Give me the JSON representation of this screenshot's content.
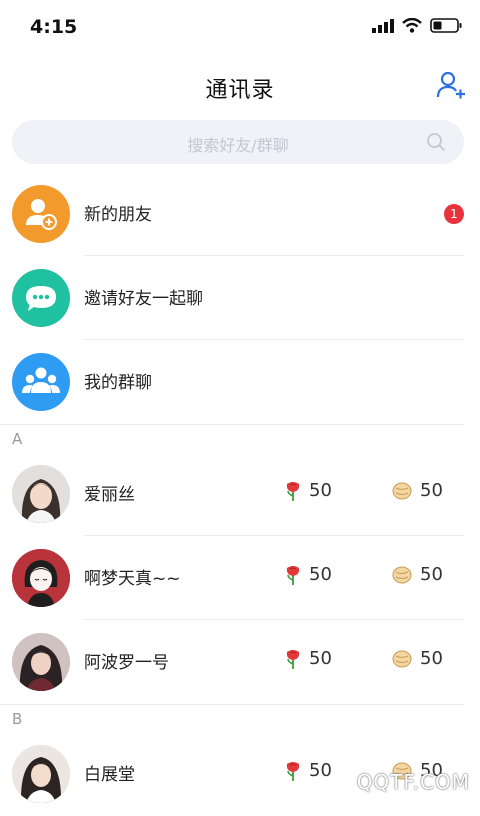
{
  "status_bar": {
    "time": "4:15"
  },
  "header": {
    "title": "通讯录"
  },
  "search": {
    "placeholder": "搜索好友/群聊"
  },
  "shortcuts": [
    {
      "label": "新的朋友",
      "badge": "1",
      "color": "#f39a2d"
    },
    {
      "label": "邀请好友一起聊",
      "color": "#20c1a0"
    },
    {
      "label": "我的群聊",
      "color": "#2e9cf3"
    }
  ],
  "sections": [
    {
      "letter": "A",
      "contacts": [
        {
          "name": "爱丽丝",
          "roses": "50",
          "buns": "50"
        },
        {
          "name": "啊梦天真~~",
          "roses": "50",
          "buns": "50"
        },
        {
          "name": "阿波罗一号",
          "roses": "50",
          "buns": "50"
        }
      ]
    },
    {
      "letter": "B",
      "contacts": [
        {
          "name": "白展堂",
          "roses": "50",
          "buns": "50"
        }
      ]
    }
  ],
  "watermark": "QQTF.COM"
}
